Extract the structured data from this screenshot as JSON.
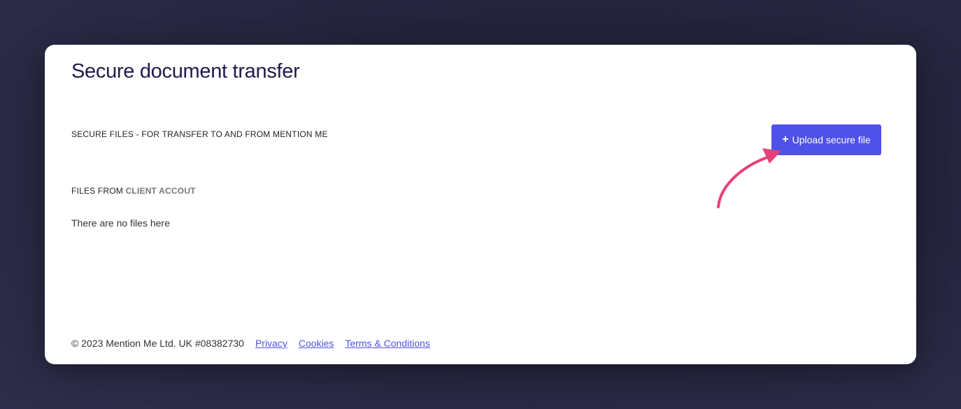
{
  "page": {
    "title": "Secure document transfer"
  },
  "secure_files": {
    "heading": "SECURE FILES - FOR TRANSFER TO AND FROM MENTION ME",
    "upload_button": {
      "icon": "plus-icon",
      "icon_glyph": "+",
      "label": "Upload secure file",
      "color": "#4f52e8"
    }
  },
  "files": {
    "heading_prefix": "FILES FROM",
    "account_name": "CLIENT ACCOUT",
    "empty_message": "There are no files here"
  },
  "annotation": {
    "arrow_color": "#e8407a"
  },
  "footer": {
    "copyright": "© 2023 Mention Me Ltd. UK #08382730",
    "links": {
      "privacy": "Privacy",
      "cookies": "Cookies",
      "terms": "Terms & Conditions"
    }
  }
}
